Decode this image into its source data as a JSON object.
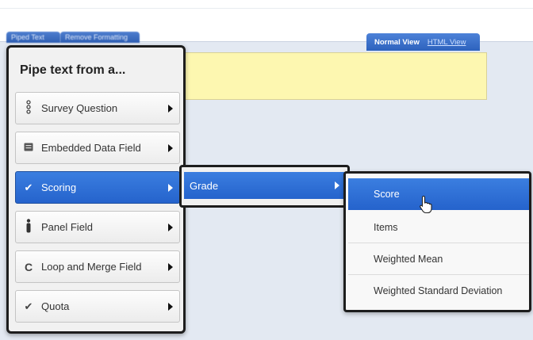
{
  "editor": {
    "tab_left_1": "Piped Text",
    "tab_left_2": "Remove Formatting",
    "normal_view": "Normal View",
    "html_view": "HTML View"
  },
  "menu": {
    "title": "Pipe text from a...",
    "items": [
      {
        "label": "Survey Question",
        "icon": "survey-question-icon",
        "active": false
      },
      {
        "label": "Embedded Data Field",
        "icon": "embedded-data-icon",
        "active": false
      },
      {
        "label": "Scoring",
        "icon": "checkmark-icon",
        "active": true
      },
      {
        "label": "Panel Field",
        "icon": "person-icon",
        "active": false
      },
      {
        "label": "Loop and Merge Field",
        "icon": "loop-icon",
        "active": false
      },
      {
        "label": "Quota",
        "icon": "checkmark-icon",
        "active": false
      }
    ]
  },
  "submenu_grade": {
    "label": "Grade"
  },
  "submenu_score": {
    "items": [
      "Score",
      "Items",
      "Weighted Mean",
      "Weighted Standard Deviation"
    ],
    "active_index": 0
  },
  "colors": {
    "accent": "#2f6fd6",
    "highlight_yellow": "#fdf7b0"
  }
}
